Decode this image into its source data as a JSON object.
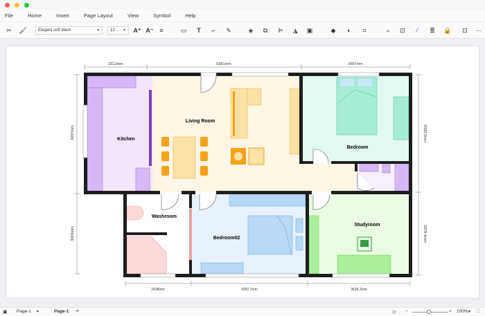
{
  "window": {
    "dots": [
      "#ff5f57",
      "#febc2e",
      "#28c840"
    ]
  },
  "menu": [
    "File",
    "Home",
    "Insert",
    "Page Layout",
    "View",
    "Symbol",
    "Help"
  ],
  "toolbar": {
    "font_name": "Elegant soft black",
    "font_size": "12"
  },
  "plan": {
    "rooms": {
      "kitchen": "Kitchen",
      "living": "Living Room",
      "bedroom": "Bedroom",
      "washroom": "Washroom",
      "bedroom02": "Bedroom02",
      "studyroom": "Studyroom"
    },
    "dims": {
      "top1": "2312mm",
      "top2": "5361mm",
      "top3": "3997mm",
      "left1": "4207mm",
      "left2": "3024mm",
      "right1": "4320.9mm",
      "right2": "2978.4mm",
      "bot1": "2438mm",
      "bot2": "4252.1mm",
      "bot3": "3628.2mm"
    },
    "colors": {
      "kitchen": "#f1e6fb",
      "living": "#fff6e6",
      "bedroom": "#e2f9f2",
      "bedroom02": "#e8f2fd",
      "studyroom": "#eafbe4",
      "washroom": "#ffffff",
      "wall": "#1e1e1e",
      "accent_orange": "#f5a31a"
    }
  },
  "status": {
    "page_tab_1": "Page-1",
    "page_tab_2": "Page-1",
    "add": "+",
    "zoom": "100%"
  }
}
